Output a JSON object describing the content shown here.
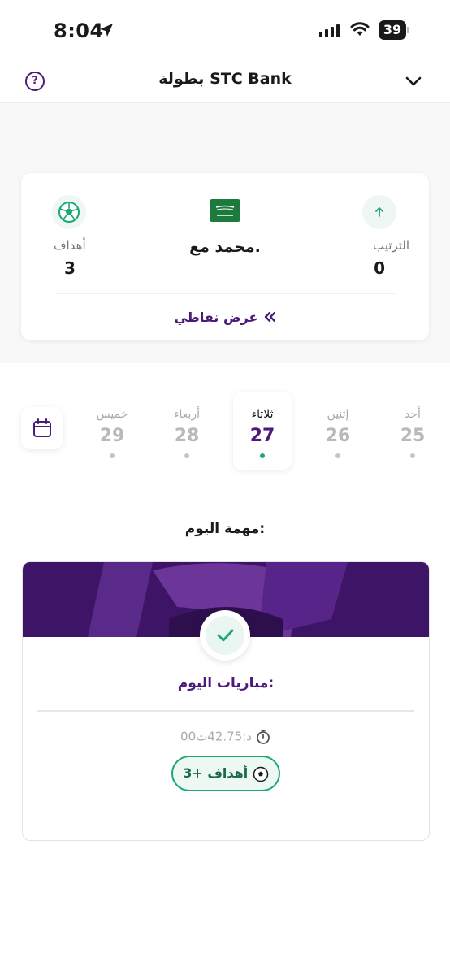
{
  "status_bar": {
    "time": "8:04",
    "battery": "39"
  },
  "header": {
    "title": "بطولة STC Bank",
    "help": "?"
  },
  "profile": {
    "name": "محمد مع.",
    "rank_label": "الترتيب",
    "rank_value": "0",
    "goals_label": "أهداف",
    "goals_value": "3",
    "points_link": "عرض نقاطي"
  },
  "days": [
    {
      "name": "أحد",
      "num": "25"
    },
    {
      "name": "إثنين",
      "num": "26"
    },
    {
      "name": "ثلاثاء",
      "num": "27",
      "active": true
    },
    {
      "name": "أربعاء",
      "num": "28"
    },
    {
      "name": "خميس",
      "num": "29"
    }
  ],
  "task": {
    "heading": "مهمة اليوم:",
    "title": "مباريات اليوم:",
    "timer": "00د:42.75ث",
    "reward": "3+ أهداف"
  },
  "colors": {
    "brand_purple": "#4b1a7a",
    "accent_green": "#1aa874"
  }
}
